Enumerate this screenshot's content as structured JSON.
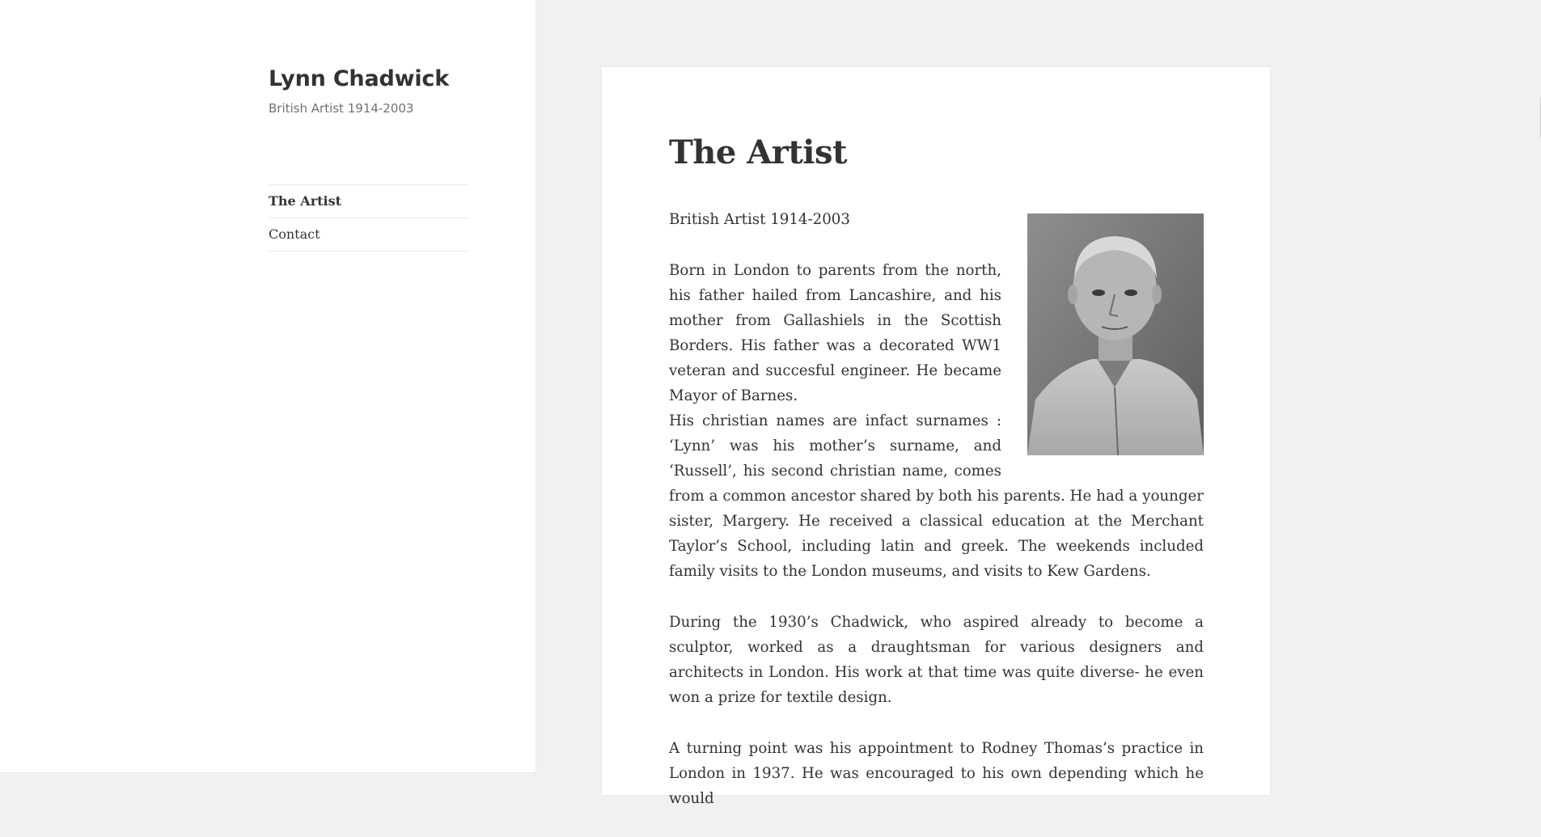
{
  "site": {
    "title": "Lynn Chadwick",
    "description": "British Artist 1914-2003"
  },
  "nav": {
    "items": [
      {
        "label": "The Artist",
        "current": true
      },
      {
        "label": "Contact",
        "current": false
      }
    ]
  },
  "article": {
    "title": "The Artist",
    "intro": "British Artist 1914-2003",
    "para1": "Born in London to parents from the north, his father hailed from Lancashire, and his mother from Gallashiels in the Scottish Borders. His father was a decorated WW1 veteran and succesful engineer. He became Mayor of Barnes.",
    "para2": "His christian names are infact surnames : ‘Lynn’ was his mother’s surname, and ‘Russell’, his second christian name, comes from a common ancestor shared by both his parents. He had a younger sister, Margery. He received a classical education at the Merchant Taylor’s School, including latin and greek. The weekends included family visits to the London museums, and visits to Kew Gardens.",
    "para3": "During the 1930’s Chadwick, who aspired already to become a sculptor, worked as a draughtsman for various designers and architects in London. His work at that time was quite diverse- he even won a prize for textile design.",
    "para4": "A turning point was his appointment to Rodney Thomas’s practice in London in 1937. He was encouraged to his own depending which he would"
  },
  "colors": {
    "page_bg": "#f1f1f1",
    "panel_bg": "#ffffff",
    "text": "#333333",
    "muted": "#707070",
    "divider": "#eaeaea"
  }
}
